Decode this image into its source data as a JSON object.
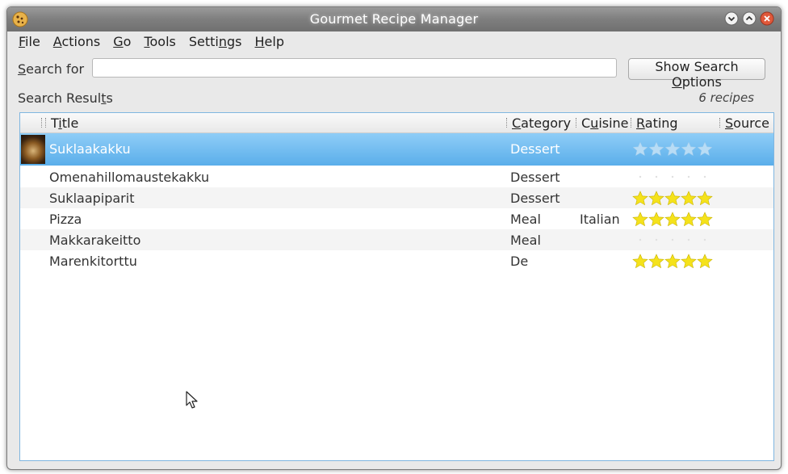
{
  "window": {
    "title": "Gourmet Recipe Manager"
  },
  "icons": {
    "app": "cookie-icon",
    "minimize": "minimize-icon",
    "maximize": "maximize-icon",
    "close": "close-icon",
    "cursor": "mouse-pointer-icon"
  },
  "menu": {
    "items": [
      {
        "key": "F",
        "rest": "ile"
      },
      {
        "key": "A",
        "rest": "ctions"
      },
      {
        "key": "G",
        "rest": "o"
      },
      {
        "key": "T",
        "rest": "ools"
      },
      {
        "pre": "Setti",
        "key": "n",
        "rest": "gs"
      },
      {
        "key": "H",
        "rest": "elp"
      }
    ]
  },
  "search": {
    "label_key": "S",
    "label_rest": "earch for",
    "value": "",
    "placeholder": "",
    "options_pre": "Show Search ",
    "options_key": "O",
    "options_rest": "ptions"
  },
  "results": {
    "label_pre": "Search Resul",
    "label_key": "t",
    "label_rest": "s",
    "count": "6 recipes"
  },
  "columns": [
    {
      "name": "title",
      "pre": "T",
      "key": "i",
      "rest": "tle"
    },
    {
      "name": "category",
      "pre": "",
      "key": "C",
      "rest": "ategory"
    },
    {
      "name": "cuisine",
      "pre": "C",
      "key": "u",
      "rest": "isine"
    },
    {
      "name": "rating",
      "pre": "",
      "key": "R",
      "rest": "ating"
    },
    {
      "name": "source",
      "pre": "",
      "key": "S",
      "rest": "ource"
    }
  ],
  "recipes": [
    {
      "title": "Suklaakakku",
      "category": "Dessert",
      "cuisine": "",
      "rating": 0,
      "selected": true,
      "has_image": true
    },
    {
      "title": "Omenahillomaustekakku",
      "category": "Dessert",
      "cuisine": "",
      "rating": 0,
      "selected": false,
      "has_image": false
    },
    {
      "title": "Suklaapiparit",
      "category": "Dessert",
      "cuisine": "",
      "rating": 5,
      "selected": false,
      "has_image": false
    },
    {
      "title": "Pizza",
      "category": "Meal",
      "cuisine": "Italian",
      "rating": 5,
      "selected": false,
      "has_image": false
    },
    {
      "title": "Makkarakeitto",
      "category": "Meal",
      "cuisine": "",
      "rating": 0,
      "selected": false,
      "has_image": false
    },
    {
      "title": "Marenkitorttu",
      "category": "De",
      "cuisine": "",
      "rating": 5,
      "selected": false,
      "has_image": false
    }
  ],
  "colors": {
    "selection": "#5aaeea",
    "star_filled": "#f5e21b",
    "star_empty_selected": "#b8dcf5",
    "star_empty": "#e0e0e0"
  }
}
